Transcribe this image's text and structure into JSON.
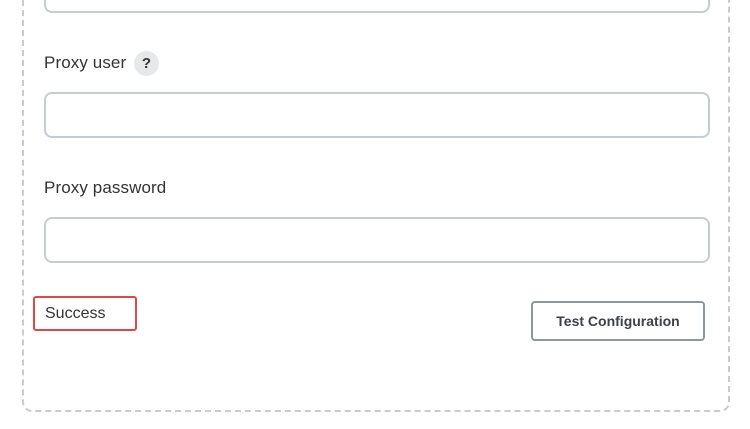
{
  "form": {
    "proxy_user": {
      "label": "Proxy user",
      "help_icon": "question-icon",
      "help_glyph": "?",
      "value": "",
      "placeholder": ""
    },
    "proxy_password": {
      "label": "Proxy password",
      "value": "",
      "placeholder": ""
    },
    "previous_field": {
      "value": ""
    }
  },
  "status": {
    "text": "Success",
    "border_color": "#e04747"
  },
  "actions": {
    "test_configuration_label": "Test Configuration"
  }
}
